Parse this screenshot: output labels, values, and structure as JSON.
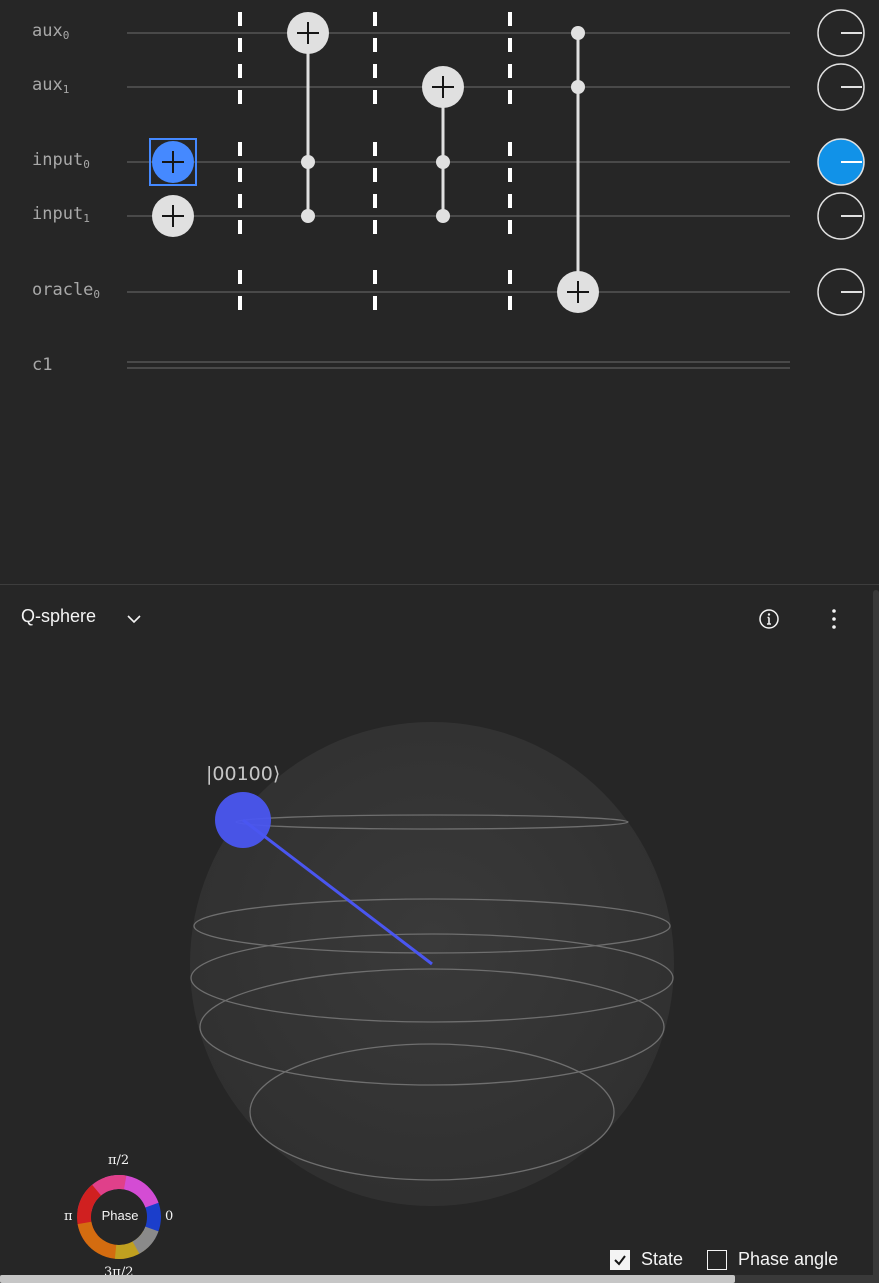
{
  "circuit": {
    "qubits": [
      {
        "name": "aux",
        "index": "0"
      },
      {
        "name": "aux",
        "index": "1"
      },
      {
        "name": "input",
        "index": "0"
      },
      {
        "name": "input",
        "index": "1"
      },
      {
        "name": "oracle",
        "index": "0"
      }
    ],
    "classical_register": "c1",
    "selected_gate_color": "#4589ff",
    "measure_active_color": "#0f62fe"
  },
  "qsphere": {
    "title": "Q-sphere",
    "state_label": "|00100⟩",
    "state_color": "#4a56f0"
  },
  "phase_legend": {
    "center": "Phase",
    "top": "π/2",
    "left": "π",
    "right": "0",
    "bottom": "3π/2"
  },
  "options": {
    "state_label": "State",
    "state_checked": true,
    "phase_angle_label": "Phase angle",
    "phase_angle_checked": false
  },
  "icons": {
    "dropdown": "chevron-down-icon",
    "info": "info-icon",
    "menu": "overflow-menu-icon"
  }
}
